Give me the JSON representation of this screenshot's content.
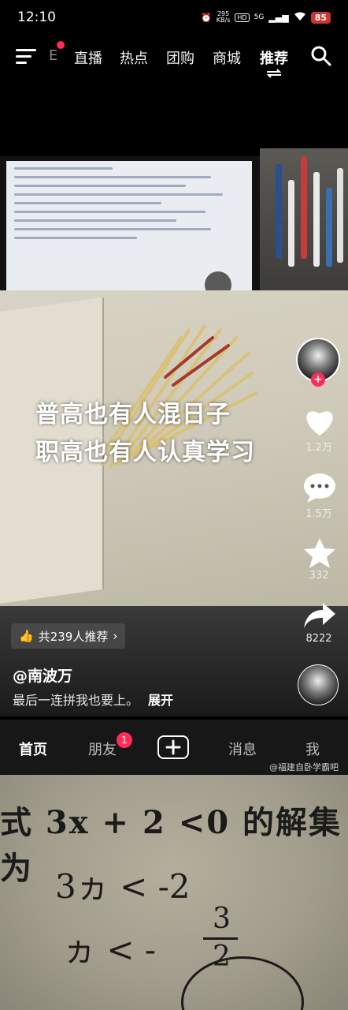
{
  "status_bar": {
    "time": "12:10",
    "net_speed_value": "295",
    "net_speed_unit": "KB/s",
    "hd_label": "HD",
    "signal_label": "5G",
    "battery": "85"
  },
  "top_nav": {
    "partial_tab": "E",
    "tabs": [
      "直播",
      "热点",
      "团购",
      "商城",
      "推荐"
    ],
    "active_tab": "推荐",
    "accent": "#ff2c55"
  },
  "video": {
    "caption_lines": [
      "普高也有人混日子",
      "职高也有人认真学习"
    ]
  },
  "rail": {
    "like_count": "1.2万",
    "comment_count": "1.5万",
    "favorite_count": "332",
    "share_count": "8222",
    "follow_symbol": "+"
  },
  "info": {
    "recommend_chip": "共239人推荐",
    "author": "@南波万",
    "description": "最后一连拼我也要上。",
    "expand": "展开"
  },
  "tab_bar": {
    "home": "首页",
    "friends": "朋友",
    "friends_badge": "1",
    "messages": "消息",
    "me": "我",
    "watermark": "@福建自卧学霸吧"
  },
  "zoom_photo": {
    "line1": "式 3x + 2 <0 的解集为",
    "line2": "3ヵ < -2",
    "line3a": "ヵ < -",
    "line3b_num": "3",
    "line3b_den": "2"
  }
}
